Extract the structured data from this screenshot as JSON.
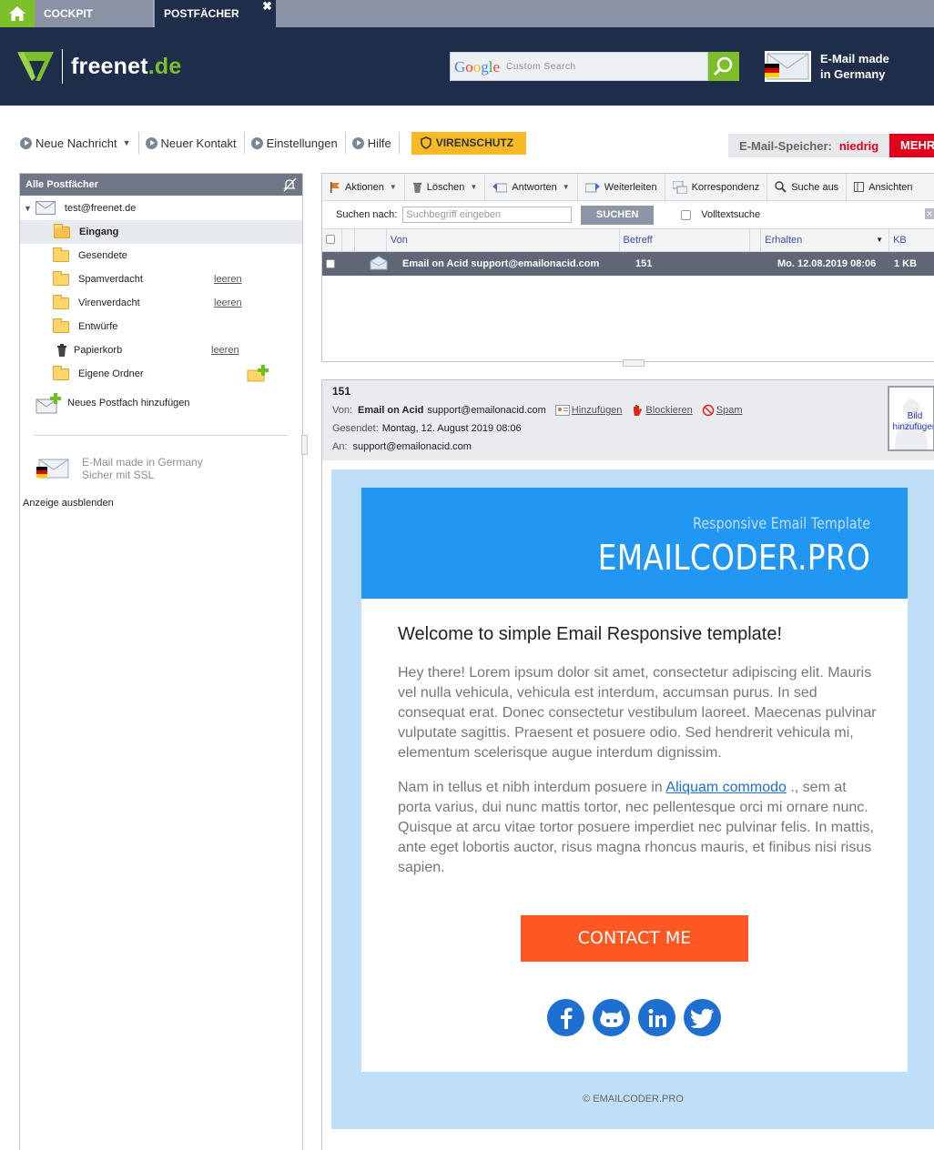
{
  "tabs": {
    "cockpit": "COCKPIT",
    "postfaecher": "POSTFÄCHER",
    "close": "✖"
  },
  "header": {
    "logo_main": "freenet",
    "logo_tld": ".de",
    "google": "Google",
    "search_placeholder": "Custom Search",
    "made_line1": "E-Mail made",
    "made_line2": "in Germany"
  },
  "toolbar": {
    "new_message": "Neue Nachricht",
    "new_contact": "Neuer Kontakt",
    "settings": "Einstellungen",
    "help": "Hilfe",
    "virus": "VIRENSCHUTZ",
    "storage_label": "E-Mail-Speicher:",
    "storage_value": "niedrig",
    "more": "MEHR"
  },
  "sidebar": {
    "title": "Alle Postfächer",
    "account": "test@freenet.de",
    "folders": [
      {
        "label": "Eingang"
      },
      {
        "label": "Gesendete"
      },
      {
        "label": "Spamverdacht",
        "action": "leeren"
      },
      {
        "label": "Virenverdacht",
        "action": "leeren"
      },
      {
        "label": "Entwürfe"
      },
      {
        "label": "Papierkorb",
        "action": "leeren"
      },
      {
        "label": "Eigene Ordner"
      }
    ],
    "add_mailbox": "Neues Postfach hinzufügen",
    "ad_line1": "E-Mail made in Germany",
    "ad_line2": "Sicher mit SSL",
    "hide_ad": "Anzeige ausblenden"
  },
  "list": {
    "actions": [
      "Aktionen",
      "Löschen",
      "Antworten",
      "Weiterleiten",
      "Korrespondenz",
      "Suche aus",
      "Ansichten"
    ],
    "search_label": "Suchen nach:",
    "search_placeholder": "Suchbegriff eingeben",
    "search_button": "SUCHEN",
    "fulltext": "Volltextsuche",
    "columns": {
      "from": "Von",
      "subject": "Betreff",
      "received": "Erhalten",
      "size": "KB"
    },
    "messages": [
      {
        "from": "Email on Acid support@emailonacid.com",
        "subject": "151",
        "received": "Mo. 12.08.2019 08:06",
        "size": "1 KB"
      }
    ]
  },
  "message": {
    "subject": "151",
    "from_label": "Von:",
    "from_name": "Email on Acid",
    "from_email": "support@emailonacid.com",
    "add": "Hinzufügen",
    "block": "Blockieren",
    "spam": "Spam",
    "sent_label": "Gesendet:",
    "sent_value": "Montag, 12. August 2019 08:06",
    "to_label": "An:",
    "to_value": "support@emailonacid.com",
    "photo_line1": "Bild",
    "photo_line2": "hinzufügen"
  },
  "email": {
    "hero_sub": "Responsive Email Template",
    "hero_title": "EMAILCODER.PRO",
    "heading": "Welcome to simple Email Responsive template!",
    "para1": "Hey there! Lorem ipsum dolor sit amet, consectetur adipiscing elit. Mauris vel nulla vehicula, vehicula est interdum, accumsan purus. In sed consequat erat. Donec consectetur vestibulum laoreet. Maecenas pulvinar vulputate sagittis. Praesent et posuere odio. Sed hendrerit vehicula mi, elementum scelerisque augue interdum dignissim.",
    "para2_pre": "Nam in tellus et nibh interdum posuere in ",
    "para2_link": "Aliquam commodo",
    "para2_post": " ., sem at porta varius, dui nunc mattis tortor, nec pellentesque orci mi ornare nunc. Quisque at arcu vitae tortor posuere imperdiet nec pulvinar felis. In mattis, ante eget lobortis auctor, risus magna rhoncus mauris, et finibus nisi risus sapien.",
    "button": "CONTACT ME",
    "footer": "© EMAILCODER.PRO"
  },
  "colors": {
    "brand_green": "#7cbf2a",
    "navy": "#1e2d4a",
    "accent_red": "#e2001a",
    "email_blue": "#2196f3",
    "cta_orange": "#ff5722"
  }
}
